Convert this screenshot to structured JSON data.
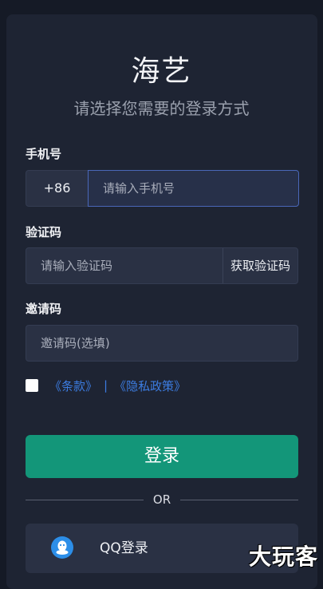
{
  "title": "海艺",
  "subtitle": "请选择您需要的登录方式",
  "phone": {
    "label": "手机号",
    "country_code": "+86",
    "placeholder": "请输入手机号"
  },
  "code": {
    "label": "验证码",
    "placeholder": "请输入验证码",
    "button": "获取验证码"
  },
  "invite": {
    "label": "邀请码",
    "placeholder": "邀请码(选填)"
  },
  "agreement": {
    "terms": "《条款》",
    "separator": "|",
    "privacy": "《隐私政策》",
    "checked": false
  },
  "login_button": "登录",
  "or_text": "OR",
  "qq_button": "QQ登录",
  "watermark": "大玩客",
  "colors": {
    "accent": "#139679",
    "link": "#3c7ce0",
    "qq": "#2c8ee8"
  }
}
